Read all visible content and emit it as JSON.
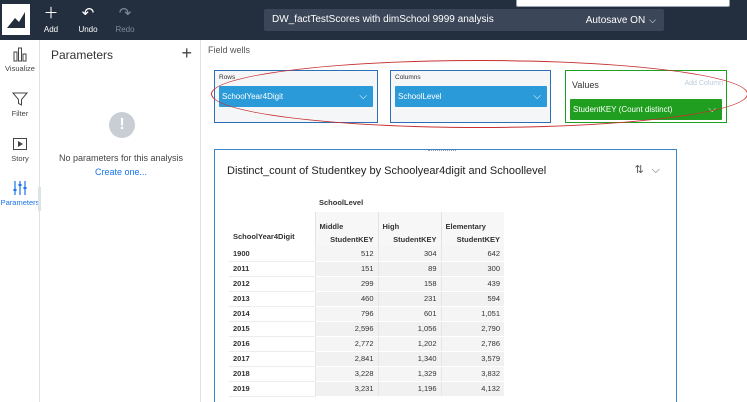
{
  "toolbar": {
    "add_label": "Add",
    "undo_label": "Undo",
    "redo_label": "Redo",
    "analysis_title": "DW_factTestScores with dimSchool 9999 analysis",
    "autosave_label": "Autosave ON"
  },
  "rail": {
    "items": [
      {
        "label": "Visualize",
        "icon": "bar-chart-icon"
      },
      {
        "label": "Filter",
        "icon": "funnel-icon"
      },
      {
        "label": "Story",
        "icon": "story-icon"
      },
      {
        "label": "Parameters",
        "icon": "sliders-icon"
      }
    ]
  },
  "parameters": {
    "title": "Parameters",
    "add_symbol": "+",
    "empty_message": "No parameters for this analysis",
    "create_link": "Create one..."
  },
  "field_wells": {
    "label": "Field wells",
    "rows": {
      "title": "Rows",
      "field": "SchoolYear4Digit"
    },
    "columns": {
      "title": "Columns",
      "field": "SchoolLevel"
    },
    "values": {
      "title": "Values",
      "field": "StudentKEY (Count distinct)",
      "hint": "Add Column"
    }
  },
  "visual": {
    "title": "Distinct_count of Studentkey by Schoolyear4digit and Schoollevel",
    "column_field": "SchoolLevel",
    "row_field": "SchoolYear4Digit",
    "measure": "StudentKEY",
    "columns": [
      "Middle",
      "High",
      "Elementary"
    ],
    "rows": [
      {
        "key": "1900",
        "values": [
          "512",
          "304",
          "642"
        ]
      },
      {
        "key": "2011",
        "values": [
          "151",
          "89",
          "300"
        ]
      },
      {
        "key": "2012",
        "values": [
          "299",
          "158",
          "439"
        ]
      },
      {
        "key": "2013",
        "values": [
          "460",
          "231",
          "594"
        ]
      },
      {
        "key": "2014",
        "values": [
          "796",
          "601",
          "1,051"
        ]
      },
      {
        "key": "2015",
        "values": [
          "2,596",
          "1,056",
          "2,790"
        ]
      },
      {
        "key": "2016",
        "values": [
          "2,772",
          "1,202",
          "2,786"
        ]
      },
      {
        "key": "2017",
        "values": [
          "2,841",
          "1,340",
          "3,579"
        ]
      },
      {
        "key": "2018",
        "values": [
          "3,228",
          "1,329",
          "3,832"
        ]
      },
      {
        "key": "2019",
        "values": [
          "3,231",
          "1,196",
          "4,132"
        ]
      }
    ]
  },
  "colors": {
    "topbar": "#232f3e",
    "pill_blue": "#2a9ad8",
    "pill_green": "#1f9e1f",
    "annotation_red": "#c73030"
  }
}
